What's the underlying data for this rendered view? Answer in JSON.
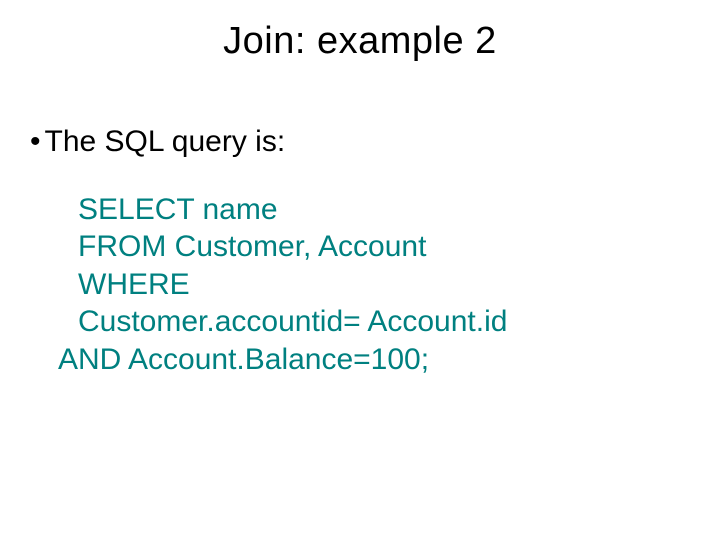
{
  "title": "Join: example 2",
  "bullet": {
    "marker": "•",
    "text": "The SQL query is:"
  },
  "sql": {
    "line1": "SELECT name",
    "line2": "FROM Customer, Account",
    "line3": "WHERE",
    "line4": "Customer.accountid= Account.id",
    "line5": "AND Account.Balance=100;"
  }
}
